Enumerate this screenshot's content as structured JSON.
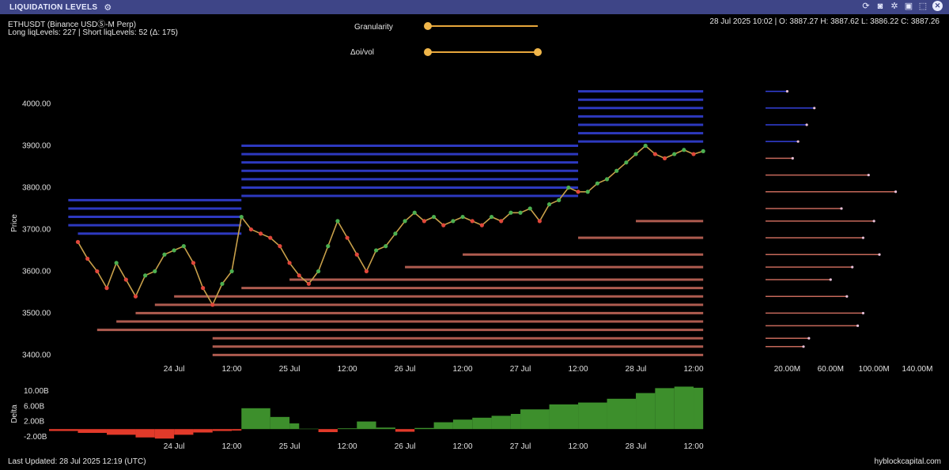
{
  "header": {
    "title": "LIQUIDATION LEVELS",
    "settings_icon": "sliders-icon",
    "tool_icons": [
      "refresh-icon",
      "camera-icon",
      "gear-icon",
      "save-icon",
      "expand-icon",
      "close-icon"
    ]
  },
  "info": {
    "symbol": "ETHUSDT (Binance USDⓈ-M Perp)",
    "levels": "Long liqLevels: 227 | Short liqLevels: 52 (Δ: 175)",
    "ohlc": "28 Jul 2025 10:02 | O: 3887.27 H: 3887.62 L: 3886.22 C: 3887.26"
  },
  "controls": {
    "granularity": {
      "label": "Granularity",
      "value": 0
    },
    "oi_vol": {
      "label": "Δoi/vol",
      "range": [
        0,
        1
      ]
    }
  },
  "footer": {
    "last_updated": "Last Updated: 28 Jul 2025 12:19 (UTC)",
    "brand": "hyblockcapital.com"
  },
  "colors": {
    "header_bg": "#3e4587",
    "short_levels": "#3c4cff",
    "long_levels": "#e87a6a",
    "candle_up": "#4caf50",
    "candle_down": "#e0473a",
    "delta_pos": "#3d8f2c",
    "delta_neg": "#e23a2a"
  },
  "chart_data": [
    {
      "type": "line",
      "ylabel": "Price",
      "ylim": [
        3380,
        4050
      ],
      "yticks": [
        4000,
        3900,
        3800,
        3700,
        3600,
        3500,
        3400
      ],
      "ytick_labels": [
        "4000.00",
        "3900.00",
        "3800.00",
        "3700.00",
        "3600.00",
        "3500.00",
        "3400.00"
      ],
      "xlim": [
        -26,
        120
      ],
      "xticks": [
        0,
        12,
        24,
        36,
        48,
        60,
        72,
        84,
        96,
        108
      ],
      "xtick_labels": [
        "24 Jul",
        "12:00",
        "25 Jul",
        "12:00",
        "26 Jul",
        "12:00",
        "27 Jul",
        "12:00",
        "28 Jul",
        "12:00"
      ],
      "price_series": {
        "x": [
          -20,
          -18,
          -16,
          -14,
          -12,
          -10,
          -8,
          -6,
          -4,
          -2,
          0,
          2,
          4,
          6,
          8,
          10,
          12,
          14,
          16,
          18,
          20,
          22,
          24,
          26,
          28,
          30,
          32,
          34,
          36,
          38,
          40,
          42,
          44,
          46,
          48,
          50,
          52,
          54,
          56,
          58,
          60,
          62,
          64,
          66,
          68,
          70,
          72,
          74,
          76,
          78,
          80,
          82,
          84,
          86,
          88,
          90,
          92,
          94,
          96,
          98,
          100,
          102,
          104,
          106,
          108,
          110
        ],
        "y": [
          3670,
          3630,
          3600,
          3560,
          3620,
          3580,
          3540,
          3590,
          3600,
          3640,
          3650,
          3660,
          3620,
          3560,
          3520,
          3570,
          3600,
          3730,
          3700,
          3690,
          3680,
          3660,
          3620,
          3590,
          3570,
          3600,
          3660,
          3720,
          3680,
          3640,
          3600,
          3650,
          3660,
          3690,
          3720,
          3740,
          3720,
          3730,
          3710,
          3720,
          3730,
          3720,
          3710,
          3730,
          3720,
          3740,
          3740,
          3750,
          3720,
          3760,
          3770,
          3800,
          3790,
          3790,
          3810,
          3820,
          3840,
          3860,
          3880,
          3900,
          3880,
          3870,
          3880,
          3890,
          3880,
          3887
        ]
      },
      "short_levels": {
        "color": "#3c4cff",
        "segments": [
          {
            "price": 3770,
            "from": -22,
            "to": 14
          },
          {
            "price": 3750,
            "from": -22,
            "to": 14
          },
          {
            "price": 3730,
            "from": -22,
            "to": 14
          },
          {
            "price": 3710,
            "from": -22,
            "to": 14
          },
          {
            "price": 3690,
            "from": -20,
            "to": 14
          },
          {
            "price": 3900,
            "from": 14,
            "to": 84
          },
          {
            "price": 3880,
            "from": 14,
            "to": 84
          },
          {
            "price": 3860,
            "from": 14,
            "to": 84
          },
          {
            "price": 3840,
            "from": 14,
            "to": 84
          },
          {
            "price": 3820,
            "from": 14,
            "to": 84
          },
          {
            "price": 3800,
            "from": 14,
            "to": 84
          },
          {
            "price": 3780,
            "from": 14,
            "to": 84
          },
          {
            "price": 4030,
            "from": 84,
            "to": 110
          },
          {
            "price": 4010,
            "from": 84,
            "to": 110
          },
          {
            "price": 3990,
            "from": 84,
            "to": 110
          },
          {
            "price": 3970,
            "from": 84,
            "to": 110
          },
          {
            "price": 3950,
            "from": 84,
            "to": 110
          },
          {
            "price": 3930,
            "from": 84,
            "to": 110
          },
          {
            "price": 3910,
            "from": 84,
            "to": 110
          }
        ]
      },
      "long_levels": {
        "color": "#e87a6a",
        "segments": [
          {
            "price": 3720,
            "from": 96,
            "to": 110
          },
          {
            "price": 3680,
            "from": 84,
            "to": 110
          },
          {
            "price": 3640,
            "from": 60,
            "to": 110
          },
          {
            "price": 3610,
            "from": 48,
            "to": 110
          },
          {
            "price": 3580,
            "from": 24,
            "to": 110
          },
          {
            "price": 3560,
            "from": 14,
            "to": 110
          },
          {
            "price": 3540,
            "from": 0,
            "to": 110
          },
          {
            "price": 3520,
            "from": -4,
            "to": 110
          },
          {
            "price": 3500,
            "from": -8,
            "to": 110
          },
          {
            "price": 3480,
            "from": -12,
            "to": 110
          },
          {
            "price": 3460,
            "from": -16,
            "to": 110
          },
          {
            "price": 3440,
            "from": 8,
            "to": 110
          },
          {
            "price": 3420,
            "from": 8,
            "to": 110
          },
          {
            "price": 3400,
            "from": 8,
            "to": 110
          }
        ]
      }
    },
    {
      "type": "bar",
      "xlabel": "",
      "xlim": [
        0,
        140000000
      ],
      "xticks": [
        20000000,
        60000000,
        100000000,
        140000000
      ],
      "xtick_labels": [
        "20.00M",
        "60.00M",
        "100.00M",
        "140.00M"
      ],
      "bars": [
        {
          "price": 4030,
          "value": 20000000
        },
        {
          "price": 3990,
          "value": 45000000
        },
        {
          "price": 3950,
          "value": 38000000
        },
        {
          "price": 3910,
          "value": 30000000
        },
        {
          "price": 3870,
          "value": 25000000
        },
        {
          "price": 3830,
          "value": 95000000
        },
        {
          "price": 3790,
          "value": 120000000
        },
        {
          "price": 3750,
          "value": 70000000
        },
        {
          "price": 3720,
          "value": 100000000
        },
        {
          "price": 3680,
          "value": 90000000
        },
        {
          "price": 3640,
          "value": 105000000
        },
        {
          "price": 3610,
          "value": 80000000
        },
        {
          "price": 3580,
          "value": 60000000
        },
        {
          "price": 3540,
          "value": 75000000
        },
        {
          "price": 3500,
          "value": 90000000
        },
        {
          "price": 3470,
          "value": 85000000
        },
        {
          "price": 3440,
          "value": 40000000
        },
        {
          "price": 3420,
          "value": 35000000
        }
      ]
    },
    {
      "type": "area",
      "ylabel": "Delta",
      "ylim": [
        -3500000000,
        11500000000
      ],
      "yticks": [
        10000000000,
        6000000000,
        2000000000,
        -2000000000
      ],
      "ytick_labels": [
        "10.00B",
        "6.00B",
        "2.00B",
        "-2.00B"
      ],
      "x": [
        -26,
        -20,
        -14,
        -8,
        -4,
        0,
        4,
        8,
        12,
        14,
        20,
        24,
        26,
        30,
        34,
        38,
        42,
        46,
        50,
        54,
        58,
        62,
        66,
        70,
        72,
        78,
        84,
        90,
        96,
        100,
        104,
        108,
        110
      ],
      "values": [
        -500000000,
        -1000000000,
        -1500000000,
        -2200000000,
        -2500000000,
        -1500000000,
        -900000000,
        -500000000,
        -400000000,
        5500000000,
        3200000000,
        1500000000,
        100000000,
        -800000000,
        200000000,
        2000000000,
        400000000,
        -700000000,
        300000000,
        1800000000,
        2500000000,
        3000000000,
        3500000000,
        4000000000,
        5200000000,
        6500000000,
        7000000000,
        8000000000,
        9500000000,
        10800000000,
        11200000000,
        10900000000,
        10800000000
      ]
    }
  ]
}
